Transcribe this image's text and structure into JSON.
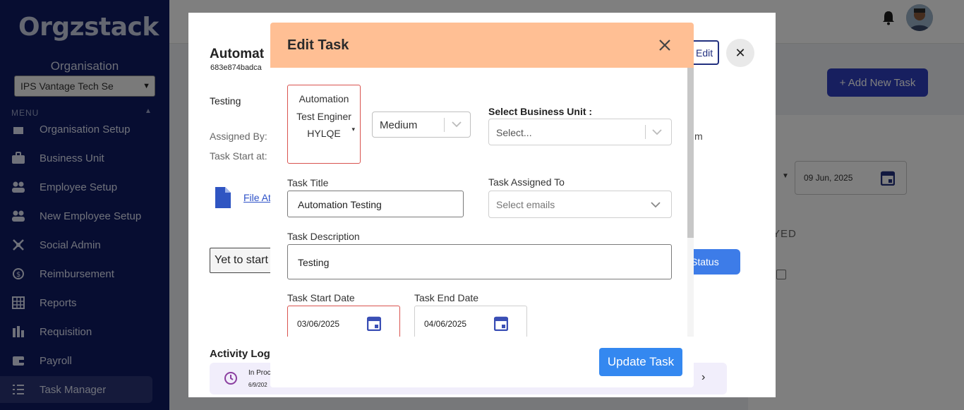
{
  "app": {
    "logo_text": "Orgzstack"
  },
  "sidebar": {
    "organisation_label": "Organisation",
    "organisation_value": "IPS Vantage Tech Se",
    "menu_label": "MENU",
    "items": [
      {
        "label": "Organisation Setup",
        "icon": "org-setup-icon"
      },
      {
        "label": "Business Unit",
        "icon": "briefcase-icon"
      },
      {
        "label": "Employee Setup",
        "icon": "users-icon"
      },
      {
        "label": "New Employee Setup",
        "icon": "user-plus-icon"
      },
      {
        "label": "Social Admin",
        "icon": "social-icon"
      },
      {
        "label": "Reimbursement",
        "icon": "money-icon"
      },
      {
        "label": "Reports",
        "icon": "grid-icon"
      },
      {
        "label": "Requisition",
        "icon": "bars-icon"
      },
      {
        "label": "Payroll",
        "icon": "wallet-icon"
      },
      {
        "label": "Task Manager",
        "icon": "list-icon"
      }
    ]
  },
  "page": {
    "add_task_label": "+ Add New Task",
    "filter_date": "09 Jun, 2025",
    "status_fragment": "YED"
  },
  "detail": {
    "title": "Automat",
    "task_id": "683e874badca",
    "edit_label": "Edit",
    "description": "Testing",
    "assigned_by_label": "Assigned By:",
    "start_at_label": "Task Start at:",
    "trailing_text": "m",
    "file_link": "File At",
    "status_value": "Yet to start",
    "status_button": "Status",
    "activity_title": "Activity Log",
    "activity": {
      "status": "In Proc",
      "date": "6/9/202"
    }
  },
  "modal": {
    "title": "Edit Task",
    "project_value": "Automation Test Enginer HYLQE",
    "priority_value": "Medium",
    "business_unit_label": "Select Business Unit :",
    "business_unit_placeholder": "Select...",
    "task_title_label": "Task Title",
    "task_title_value": "Automation Testing",
    "assigned_to_label": "Task Assigned To",
    "assigned_to_placeholder": "Select emails",
    "description_label": "Task Description",
    "description_value": "Testing",
    "start_date_label": "Task Start Date",
    "start_date_value": "03/06/2025",
    "end_date_label": "Task End Date",
    "end_date_value": "04/06/2025",
    "submit_label": "Update Task"
  },
  "colors": {
    "sidebar_bg": "#0f1b63",
    "modal_header_bg": "#ffbf94",
    "primary_button": "#3488f0",
    "error_border": "#d9534f"
  }
}
